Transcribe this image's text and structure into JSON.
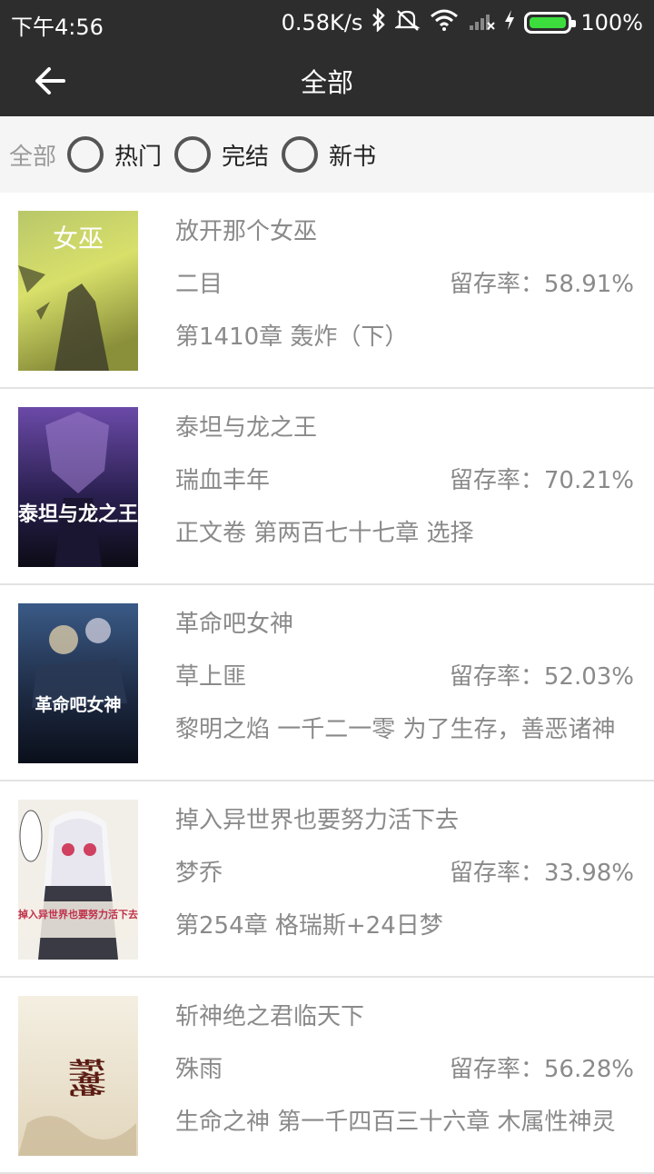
{
  "status_bar": {
    "time": "下午4:56",
    "speed": "0.58K/s",
    "battery": "100%",
    "icons": [
      "bluetooth-icon",
      "mute-icon",
      "wifi-icon",
      "signal-icon",
      "charging-icon",
      "battery-icon"
    ]
  },
  "app_bar": {
    "back_icon": "arrow-left-icon",
    "title": "全部"
  },
  "filter": {
    "label": "全部",
    "options": [
      "热门",
      "完结",
      "新书"
    ]
  },
  "books": [
    {
      "title": "放开那个女巫",
      "author": "二目",
      "retention": "留存率：58.91%",
      "chapter": "第1410章 轰炸（下）",
      "cover_text": "女巫"
    },
    {
      "title": "泰坦与龙之王",
      "author": "瑞血丰年",
      "retention": "留存率：70.21%",
      "chapter": "正文卷 第两百七十七章 选择",
      "cover_text": "泰坦与龙之王"
    },
    {
      "title": "革命吧女神",
      "author": "草上匪",
      "retention": "留存率：52.03%",
      "chapter": "黎明之焰 一千二一零 为了生存，善恶诸神",
      "cover_text": "革命吧女神"
    },
    {
      "title": "掉入异世界也要努力活下去",
      "author": "梦乔",
      "retention": "留存率：33.98%",
      "chapter": "第254章 格瑞斯+24日梦",
      "cover_text": "掉入异世界也要努力活下去"
    },
    {
      "title": "斩神绝之君临天下",
      "author": "殊雨",
      "retention": "留存率：56.28%",
      "chapter": "生命之神 第一千四百三十六章 木属性神灵",
      "cover_text": "斩神绝"
    }
  ]
}
